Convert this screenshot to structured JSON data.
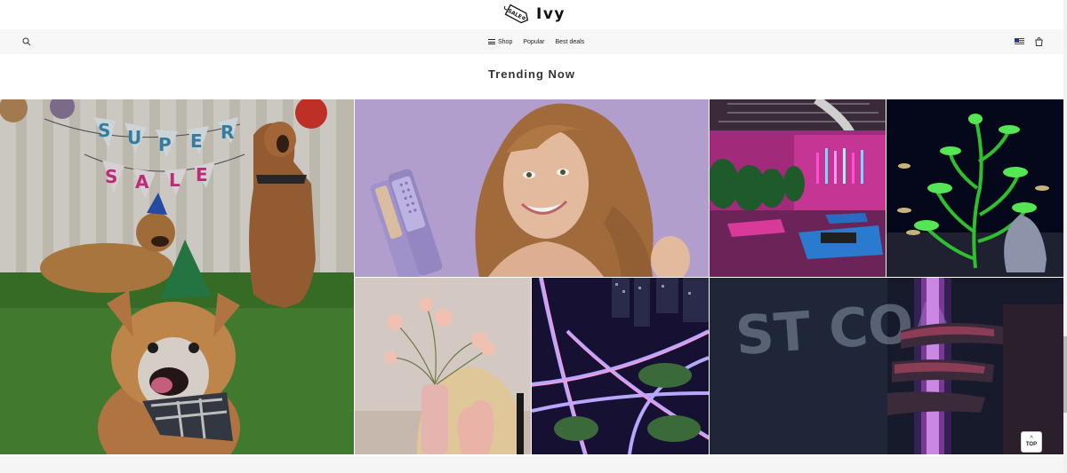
{
  "brand": {
    "tag_text": "SALE",
    "name": "Ivy"
  },
  "nav": {
    "items": [
      {
        "label": "Shop",
        "icon": "hamburger-menu-icon"
      },
      {
        "label": "Popular"
      },
      {
        "label": "Best deals"
      }
    ],
    "left_icon": "search-icon",
    "right_icons": [
      "us-flag-icon",
      "shopping-bag-icon"
    ]
  },
  "section": {
    "title": "Trending Now"
  },
  "tiles": [
    {
      "subject": "dogs-party-super-sale",
      "banner_letters": [
        "S",
        "U",
        "P",
        "E",
        "R"
      ],
      "banner_letters_2": [
        "S",
        "A",
        "L",
        "E"
      ]
    },
    {
      "subject": "woman-with-hair-straightener"
    },
    {
      "subject": "neon-yoga-studio"
    },
    {
      "subject": "aquarium-plant"
    },
    {
      "subject": "flowers-vase-cat-figure"
    },
    {
      "subject": "night-highway-interchange"
    },
    {
      "subject": "neon-light-hand",
      "bg_text": "ST COA"
    }
  ],
  "top_button": {
    "arrow": "^",
    "label": "TOP"
  },
  "colors": {
    "nav_bg": "#f7f7f7",
    "text": "#222222"
  }
}
